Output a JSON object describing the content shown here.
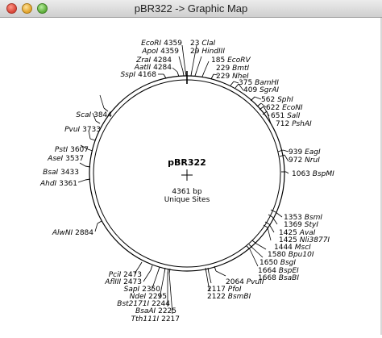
{
  "window": {
    "title": "pBR322 -> Graphic Map"
  },
  "map": {
    "name": "pBR322",
    "size": "4361 bp",
    "caption": "Unique Sites",
    "sites": [
      {
        "id": "ecori",
        "pos": "4359",
        "name": "EcoRI"
      },
      {
        "id": "apol",
        "pos": "4359",
        "name": "ApoI"
      },
      {
        "id": "zrai",
        "pos": "4284",
        "name": "ZraI"
      },
      {
        "id": "aatii",
        "pos": "4284",
        "name": "AatII"
      },
      {
        "id": "sspi",
        "pos": "4168",
        "name": "SspI"
      },
      {
        "id": "clai",
        "pos": "23",
        "name": "ClaI"
      },
      {
        "id": "hindiii",
        "pos": "29",
        "name": "HindIII"
      },
      {
        "id": "ecorv",
        "pos": "185",
        "name": "EcoRV"
      },
      {
        "id": "bmti",
        "pos": "229",
        "name": "BmtI"
      },
      {
        "id": "nhei",
        "pos": "229",
        "name": "NheI"
      },
      {
        "id": "bamhi",
        "pos": "375",
        "name": "BamHI"
      },
      {
        "id": "sgrai",
        "pos": "409",
        "name": "SgrAI"
      },
      {
        "id": "sphi",
        "pos": "562",
        "name": "SphI"
      },
      {
        "id": "econi",
        "pos": "622",
        "name": "EcoNI"
      },
      {
        "id": "sali",
        "pos": "651",
        "name": "SalI"
      },
      {
        "id": "pshai",
        "pos": "712",
        "name": "PshAI"
      },
      {
        "id": "eagi",
        "pos": "939",
        "name": "EagI"
      },
      {
        "id": "nrui",
        "pos": "972",
        "name": "NruI"
      },
      {
        "id": "bspmi",
        "pos": "1063",
        "name": "BspMI"
      },
      {
        "id": "bsmi",
        "pos": "1353",
        "name": "BsmI"
      },
      {
        "id": "styi",
        "pos": "1369",
        "name": "StyI"
      },
      {
        "id": "avai",
        "pos": "1425",
        "name": "AvaI"
      },
      {
        "id": "bsoi",
        "pos": "1425",
        "name": "Nli3877I"
      },
      {
        "id": "msci",
        "pos": "1444",
        "name": "MscI"
      },
      {
        "id": "bpu10i",
        "pos": "1580",
        "name": "Bpu10I"
      },
      {
        "id": "bsgi",
        "pos": "1650",
        "name": "BsgI"
      },
      {
        "id": "bspei",
        "pos": "1664",
        "name": "BspEI"
      },
      {
        "id": "bsabi",
        "pos": "1668",
        "name": "BsaBI"
      },
      {
        "id": "pvuii",
        "pos": "2064",
        "name": "PvuII"
      },
      {
        "id": "pfoi",
        "pos": "2117",
        "name": "PfoI"
      },
      {
        "id": "bsmbi",
        "pos": "2122",
        "name": "BsmBI"
      },
      {
        "id": "tth111i",
        "pos": "2217",
        "name": "Tth111I"
      },
      {
        "id": "bsaai",
        "pos": "2225",
        "name": "BsaAI"
      },
      {
        "id": "bst2171",
        "pos": "2244",
        "name": "Bst2171I"
      },
      {
        "id": "ndei",
        "pos": "2295",
        "name": "NdeI"
      },
      {
        "id": "sapi",
        "pos": "2350",
        "name": "SapI"
      },
      {
        "id": "aflIII",
        "pos": "2473",
        "name": "AflIII"
      },
      {
        "id": "pcii",
        "pos": "2473",
        "name": "PciI"
      },
      {
        "id": "alwni",
        "pos": "2884",
        "name": "AlwNI"
      },
      {
        "id": "ahdi",
        "pos": "3361",
        "name": "AhdI"
      },
      {
        "id": "bsai",
        "pos": "3433",
        "name": "BsaI"
      },
      {
        "id": "asei",
        "pos": "3537",
        "name": "AseI"
      },
      {
        "id": "psti",
        "pos": "3607",
        "name": "PstI"
      },
      {
        "id": "pvui",
        "pos": "3733",
        "name": "PvuI"
      },
      {
        "id": "scai",
        "pos": "3844",
        "name": "ScaI"
      }
    ]
  }
}
